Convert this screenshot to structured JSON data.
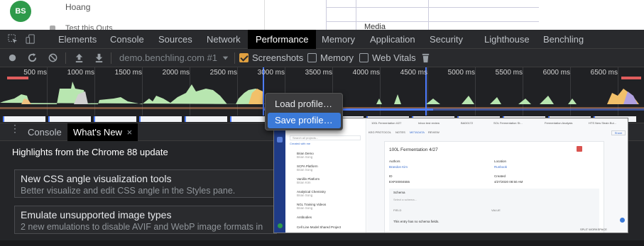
{
  "page": {
    "avatar_initials": "BS",
    "user_name": "Hoang",
    "tagline": "Test this Outs",
    "cell_text": "Media"
  },
  "devtools": {
    "tabs": [
      "Elements",
      "Console",
      "Sources",
      "Network",
      "Performance",
      "Memory",
      "Application",
      "Security",
      "Lighthouse",
      "Benchling"
    ],
    "active_tab": "Performance",
    "toolbar": {
      "target": "demo.benchling.com #1",
      "screenshots_label": "Screenshots",
      "memory_label": "Memory",
      "webvitals_label": "Web Vitals"
    },
    "timeline_ticks": [
      "500 ms",
      "1000 ms",
      "1500 ms",
      "2000 ms",
      "2500 ms",
      "3000 ms",
      "3500 ms",
      "4000 ms",
      "4500 ms",
      "5000 ms",
      "5500 ms",
      "6000 ms",
      "6500 ms"
    ],
    "context_menu": {
      "load_label": "Load profile…",
      "save_label": "Save profile…"
    },
    "drawer": {
      "console_tab": "Console",
      "whatsnew_tab": "What's New",
      "close_glyph": "×",
      "heading": "Highlights from the Chrome 88 update",
      "cards": [
        {
          "title": "New CSS angle visualization tools",
          "subtitle": "Better visualize and edit CSS angle in the Styles pane."
        },
        {
          "title": "Emulate unsupported image types",
          "subtitle": "2 new emulations to disable AVIF and WebP image formats in"
        }
      ]
    }
  },
  "screenshot_preview": {
    "tabs": [
      "100L Fermentation 4/27",
      "Inbox test review",
      "BAD0172",
      "SOL Fermentation St...",
      "Fermentation Analysis",
      "HTS New Strain Bui..."
    ],
    "subtabs": [
      "KEG PROTOCOL",
      "NOTES",
      "METADATA",
      "REVIEW"
    ],
    "list_items": [
      {
        "title": "Brian Demo",
        "sub": "Brian Song"
      },
      {
        "title": "SCPA Platform",
        "sub": "Brian Song"
      },
      {
        "title": "Vanillin Platform",
        "sub": "Brian Kim"
      },
      {
        "title": "Analytical Chemistry",
        "sub": "Brian Song"
      },
      {
        "title": "NGL Training Videos",
        "sub": "Brian Song"
      },
      {
        "title": "Antibodies",
        "sub": ""
      },
      {
        "title": "Cell Line Model Shared Project",
        "sub": ""
      }
    ],
    "search_placeholder": "Search all projects...",
    "filter_label": "Created with me",
    "entry_title": "100L Fermentation 4/27",
    "authors_label": "Authors",
    "author_value": "Brandon Kim",
    "location_label": "Location",
    "location_value": "Runbook",
    "id_label": "ID",
    "id_value": "EXP20004555",
    "created_label": "Created",
    "created_value": "4/27/2020 08:50 AM",
    "schema_label": "Schema",
    "schema_placeholder": "Select a schema...",
    "field_label": "FIELD",
    "value_label": "VALUE",
    "empty_text": "This entry has no schema fields.",
    "share_label": "Share",
    "split_label": "SPLIT WORKSPACE"
  },
  "colors": {
    "accent_blue": "#3b7ad8",
    "screenshot_checkbox": "#e0a040",
    "avatar_green": "#2e9a4a"
  }
}
